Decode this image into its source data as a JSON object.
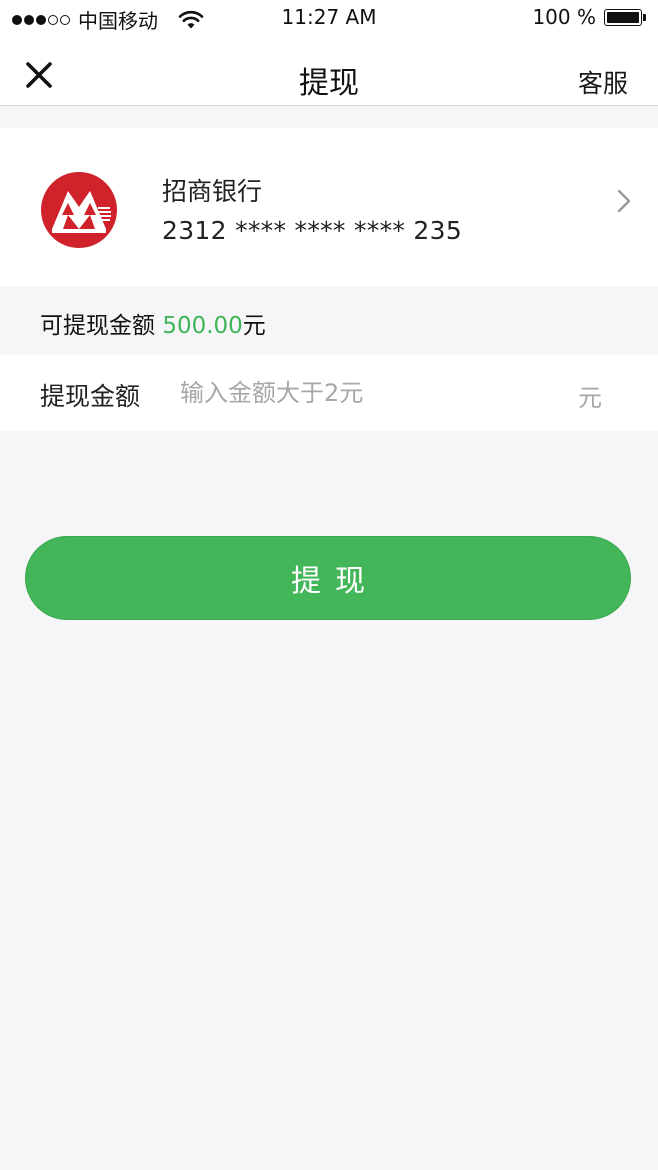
{
  "status_bar": {
    "carrier": "中国移动",
    "time": "11:27 AM",
    "battery": "100 %",
    "signal_filled": 3,
    "signal_total": 5
  },
  "nav": {
    "title": "提现",
    "service_label": "客服",
    "close_icon": "close-x-icon"
  },
  "bank_card": {
    "name": "招商银行",
    "number": "2312 **** **** **** 235",
    "logo": "cmb-bank-logo",
    "brand_color": "#d0222a"
  },
  "available": {
    "label": "可提现金额",
    "amount": "500.00",
    "unit": "元",
    "amount_color": "#3fb557"
  },
  "amount_input": {
    "label": "提现金额",
    "placeholder": "输入金额大于2元",
    "value": "",
    "unit": "元"
  },
  "actions": {
    "withdraw_label": "提现",
    "button_color": "#44b65a"
  }
}
